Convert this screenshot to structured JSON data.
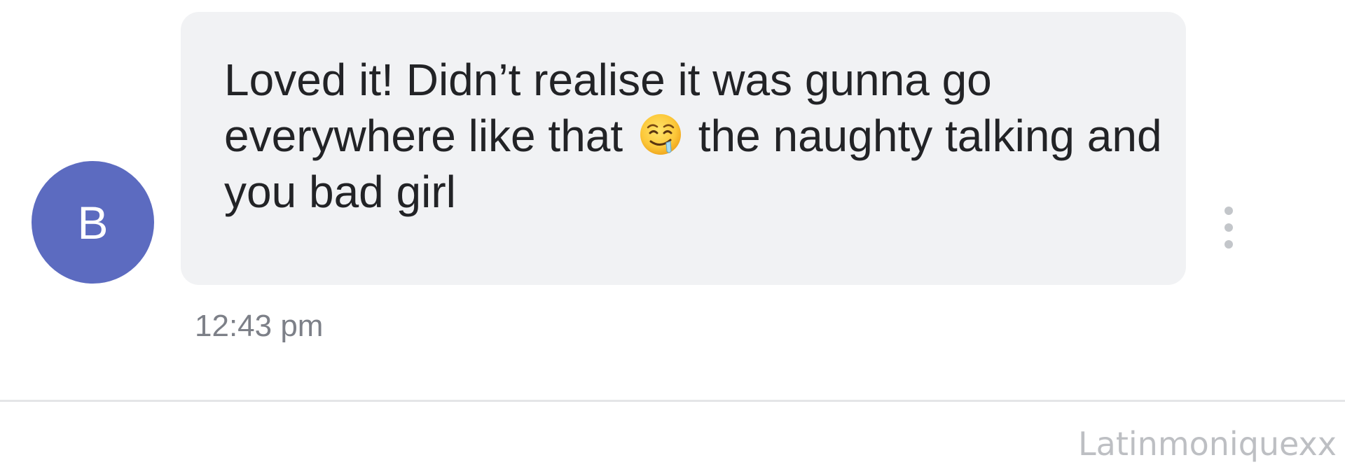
{
  "sender": {
    "avatar_initial": "B",
    "avatar_color": "#5c6bc0"
  },
  "message": {
    "text_part1": "Loved it! Didn’t realise it was gunna go everywhere like that",
    "emoji_name": "drooling-face-icon",
    "text_part2": "the naughty talking and you bad girl",
    "timestamp": "12:43 pm",
    "bubble_color": "#f1f2f4"
  },
  "actions": {
    "more_icon": "more-vert-icon"
  },
  "watermark": "Latinmoniquexx"
}
